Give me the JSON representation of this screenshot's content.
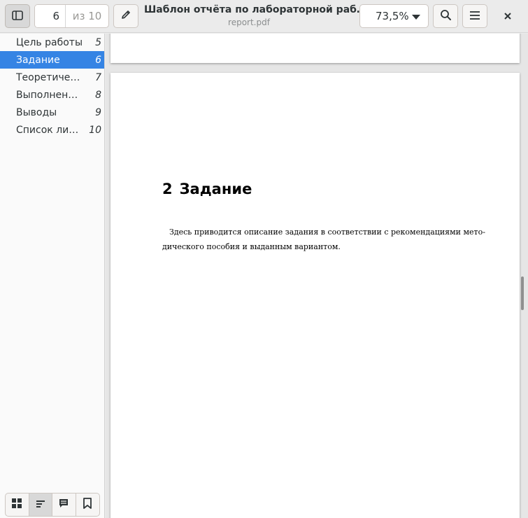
{
  "header": {
    "page_number": "6",
    "page_total": "из 10",
    "title": "Шаблон отчёта по лабораторной раб…",
    "subtitle": "report.pdf",
    "zoom": "73,5%"
  },
  "sidebar": {
    "items": [
      {
        "label": "Цель работы",
        "page": "5"
      },
      {
        "label": "Задание",
        "page": "6"
      },
      {
        "label": "Теоретичес…",
        "page": "7"
      },
      {
        "label": "Выполнение…",
        "page": "8"
      },
      {
        "label": "Выводы",
        "page": "9"
      },
      {
        "label": "Список лите…",
        "page": "10"
      }
    ],
    "selected_index": 1,
    "tabs": [
      "thumbnails-icon",
      "outline-icon",
      "annotations-icon",
      "bookmarks-icon"
    ]
  },
  "document": {
    "section_number": "2",
    "section_title": "Задание",
    "body_line1": "Здесь приводится описание задания в соответствии с рекомендациями мето-",
    "body_line2": "дического пособия и выданным вариантом."
  },
  "colors": {
    "accent": "#3584e4"
  }
}
